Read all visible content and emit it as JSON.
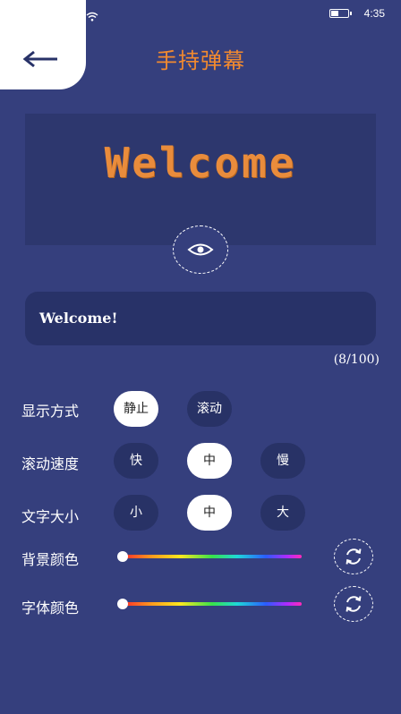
{
  "status_bar": {
    "time": "4:35",
    "battery_level": 0.45
  },
  "header": {
    "title": "手持弹幕"
  },
  "preview": {
    "text": "Welcome"
  },
  "input": {
    "value": "Welcome!",
    "count": "(8/100)"
  },
  "settings": {
    "display_mode": {
      "label": "显示方式",
      "options": [
        "静止",
        "滚动"
      ],
      "selected": "静止"
    },
    "scroll_speed": {
      "label": "滚动速度",
      "options": [
        "快",
        "中",
        "慢"
      ],
      "selected": "中"
    },
    "font_size": {
      "label": "文字大小",
      "options": [
        "小",
        "中",
        "大"
      ],
      "selected": "中"
    },
    "bg_color": {
      "label": "背景颜色",
      "value": 0
    },
    "font_color": {
      "label": "字体颜色",
      "value": 0
    }
  },
  "colors": {
    "background": "#353f7d",
    "accent": "#f28a2f",
    "panel": "#2d376e"
  },
  "icons": [
    "back-arrow-icon",
    "eye-icon",
    "refresh-icon",
    "wifi-icon",
    "battery-icon"
  ]
}
